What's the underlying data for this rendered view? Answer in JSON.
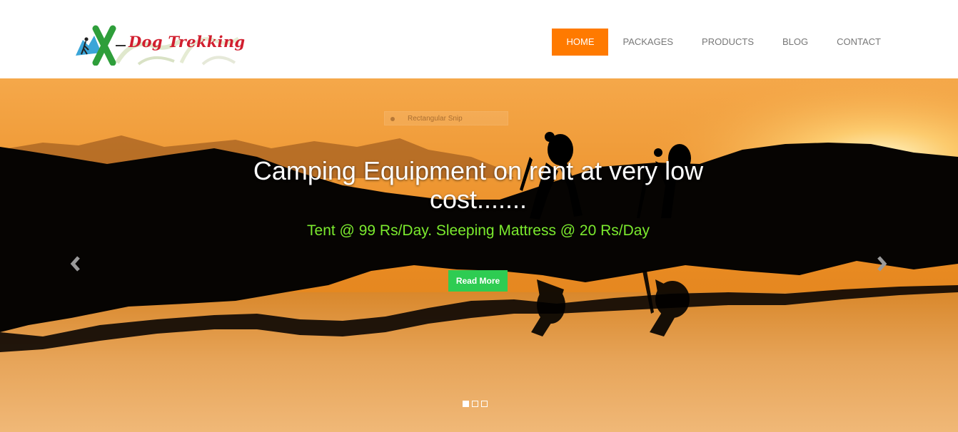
{
  "brand": {
    "name": "Dog Trekking",
    "logo_icon": "hiker-x-logo",
    "color": "#d11f2f"
  },
  "nav": {
    "items": [
      {
        "label": "HOME",
        "active": true
      },
      {
        "label": "PACKAGES",
        "active": false
      },
      {
        "label": "PRODUCTS",
        "active": false
      },
      {
        "label": "BLOG",
        "active": false
      },
      {
        "label": "CONTACT",
        "active": false
      }
    ],
    "active_color": "#ff7a00"
  },
  "overlay": {
    "label": "Rectangular Snip"
  },
  "slide": {
    "title": "Camping Equipment on rent at very low cost.......",
    "subtitle": "Tent @ 99 Rs/Day. Sleeping Mattress @ 20 Rs/Day",
    "button_label": "Read More",
    "button_color": "#2ecc52",
    "subtitle_color": "#7bea2e"
  },
  "carousel": {
    "prev_icon": "chevron-left-icon",
    "next_icon": "chevron-right-icon",
    "slide_count": 3,
    "active_index": 0
  }
}
